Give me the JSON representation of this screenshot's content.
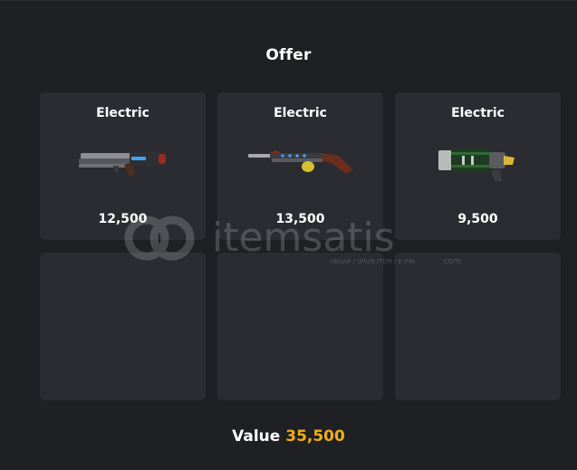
{
  "offer": {
    "title": "Offer",
    "items": [
      {
        "name": "Electric",
        "price": "12,500",
        "icon": "rifle-icon"
      },
      {
        "name": "Electric",
        "price": "13,500",
        "icon": "shotgun-icon"
      },
      {
        "name": "Electric",
        "price": "9,500",
        "icon": "launcher-icon"
      }
    ],
    "empty_slots": 3,
    "value_label": "Value",
    "value_amount": "35,500"
  },
  "watermark": {
    "brand": "itemsatis",
    "tagline": "HESAP / OYUN ITEM / E-PIN",
    "suffix": ".com"
  },
  "colors": {
    "background": "#1f2024",
    "card": "#2b2c31",
    "accent": "#f0ae1b"
  }
}
